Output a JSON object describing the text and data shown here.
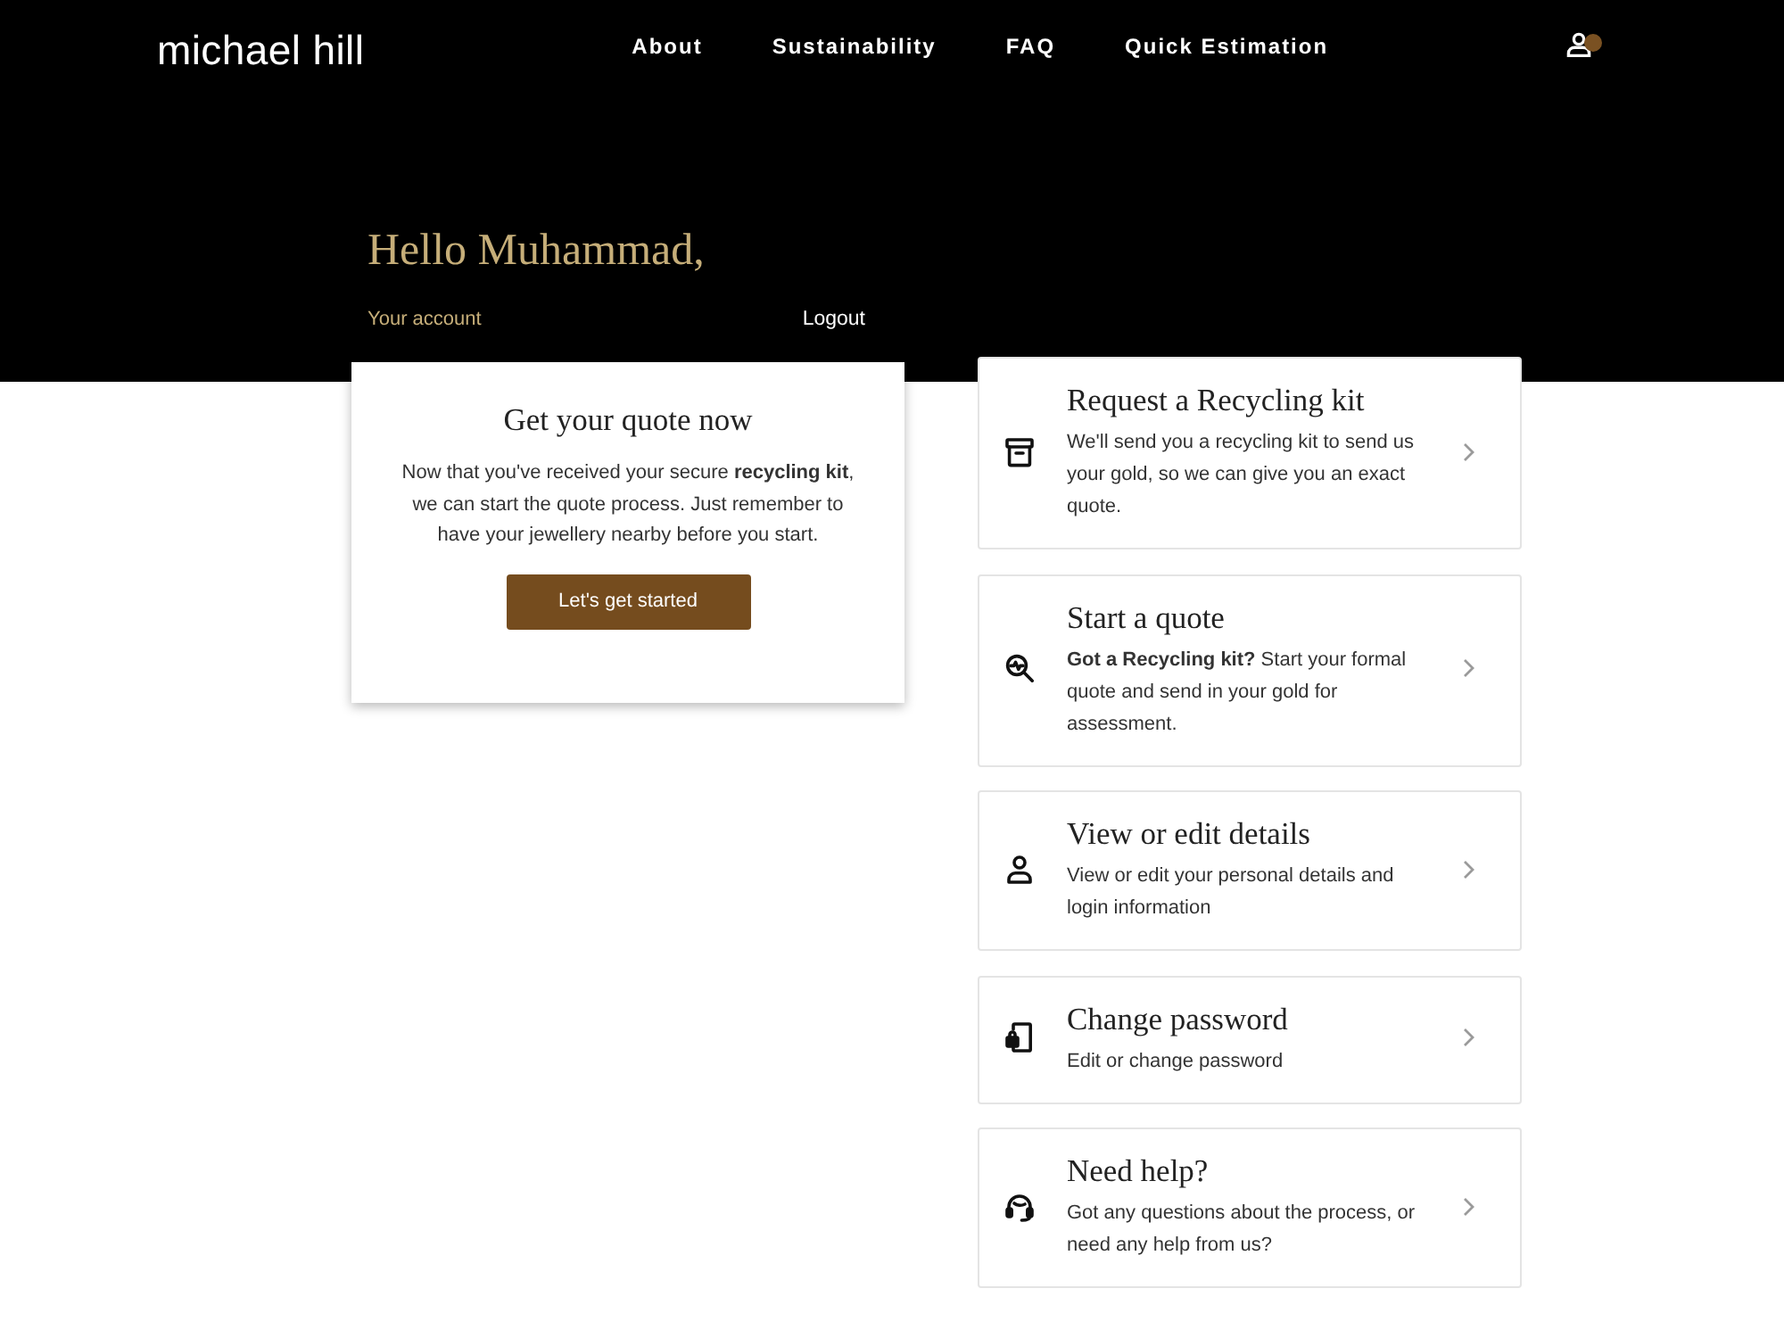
{
  "header": {
    "logo": "michael hill",
    "nav": [
      {
        "label": "About"
      },
      {
        "label": "Sustainability"
      },
      {
        "label": "FAQ"
      },
      {
        "label": "Quick Estimation"
      }
    ]
  },
  "greeting": {
    "title": "Hello Muhammad,",
    "account_label": "Your account",
    "logout": "Logout"
  },
  "quote_card": {
    "title": "Get your quote now",
    "text": "Now that you've received your secure **recycling kit**, we can start the quote process. Just remember to have your jewellery nearby before you start.",
    "button": "Let's get started"
  },
  "actions": [
    {
      "kind": "box",
      "title": "Request a Recycling kit",
      "text": "We'll send you a recycling kit to send us your gold, so we can give you an exact quote."
    },
    {
      "kind": "search",
      "title": "Start a quote",
      "text": "**Got a Recycling kit?** Start your formal quote and send in your gold for assessment."
    },
    {
      "kind": "person",
      "title": "View or edit details",
      "text": "View or edit your personal details and login information"
    },
    {
      "kind": "phone",
      "title": "Change password",
      "text": "Edit or change password"
    },
    {
      "kind": "help",
      "title": "Need help?",
      "text": "Got any questions about the process, or need any help from us?"
    }
  ]
}
